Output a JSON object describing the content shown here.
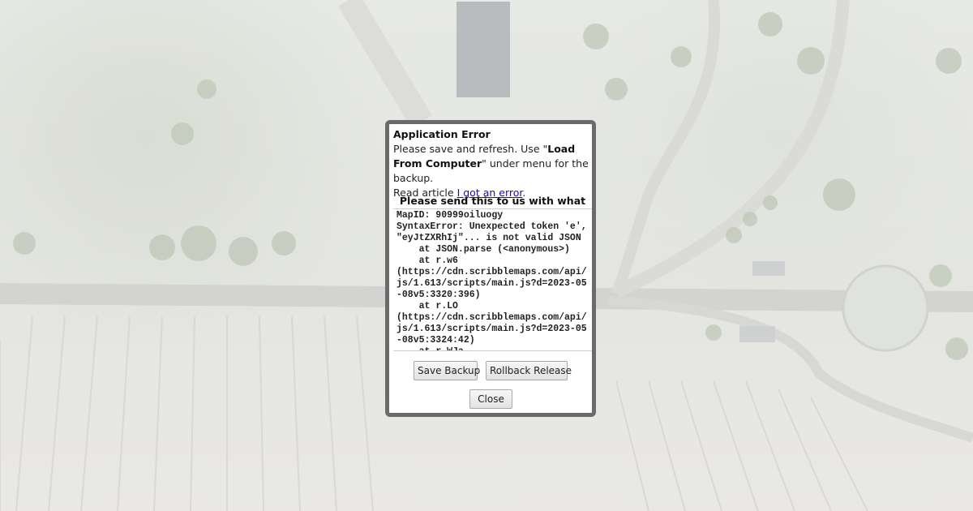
{
  "dialog": {
    "title": "Application Error",
    "line1_pre": "Please save and refresh. Use \"",
    "line1_bold": "Load From Computer",
    "line1_post": "\" under menu for the backup.",
    "line2_pre": "Read article ",
    "line2_link": "I got an error",
    "line2_post": ".",
    "send_label": "Please send this to us with what you",
    "trace": "MapID: 90999oiluogy\nSyntaxError: Unexpected token 'e', \"eyJtZXRhIj\"... is not valid JSON\n    at JSON.parse (<anonymous>)\n    at r.w6\n(https://cdn.scribblemaps.com/api/js/1.613/scripts/main.js?d=2023-05-08v5:3320:396)\n    at r.LO\n(https://cdn.scribblemaps.com/api/js/1.613/scripts/main.js?d=2023-05-08v5:3324:42)\n    at r.WJa",
    "buttons": {
      "save": "Save Backup",
      "rollback": "Rollback Release",
      "close": "Close"
    }
  }
}
